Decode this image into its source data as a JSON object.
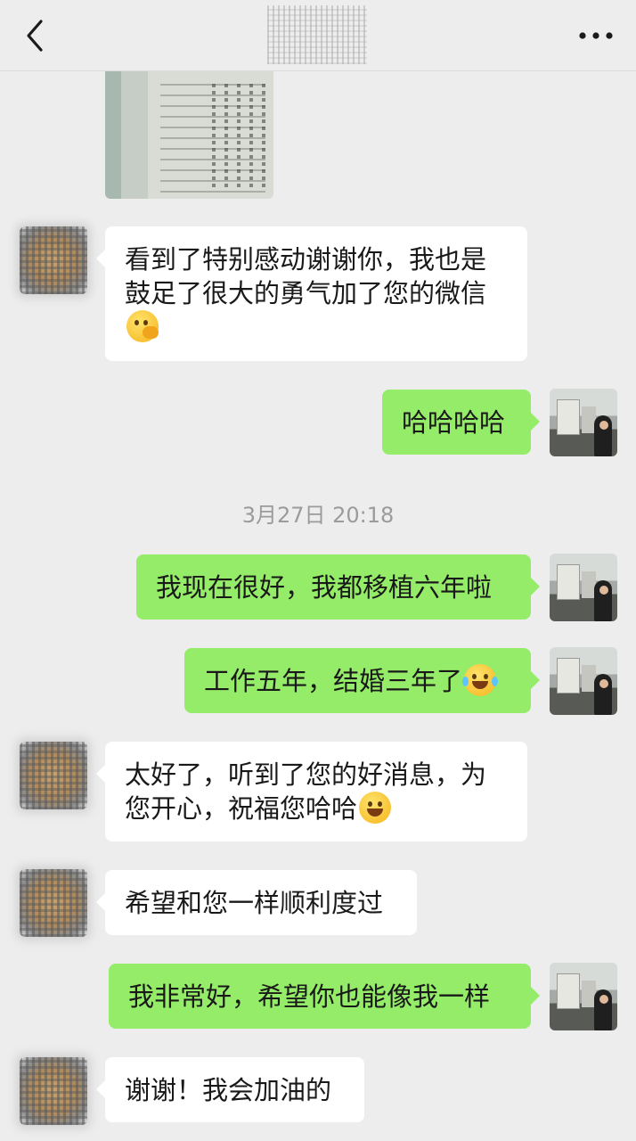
{
  "header": {
    "back_icon": "chevron-left-icon",
    "more_icon": "more-dots-icon"
  },
  "messages": [
    {
      "side": "left",
      "text": "看到了特别感动谢谢你，我也是鼓足了很大的勇气加了您的微信",
      "emoji": "peeking-face-emoji"
    },
    {
      "side": "right",
      "text": "哈哈哈哈"
    },
    {
      "side": "right",
      "text": "我现在很好，我都移植六年啦"
    },
    {
      "side": "right",
      "text": "工作五年，结婚三年了",
      "emoji": "tears-of-joy-emoji"
    },
    {
      "side": "left",
      "text": "太好了，听到了您的好消息，为您开心，祝福您哈哈",
      "emoji": "grinning-face-emoji"
    },
    {
      "side": "left",
      "text": "希望和您一样顺利度过"
    },
    {
      "side": "right",
      "text": "我非常好，希望你也能像我一样"
    },
    {
      "side": "left",
      "text": "谢谢！我会加油的"
    }
  ],
  "timestamp": "3月27日 20:18",
  "colors": {
    "background": "#ededed",
    "self_bubble": "#95ec69",
    "other_bubble": "#ffffff",
    "timestamp_text": "#9b9b9b"
  }
}
